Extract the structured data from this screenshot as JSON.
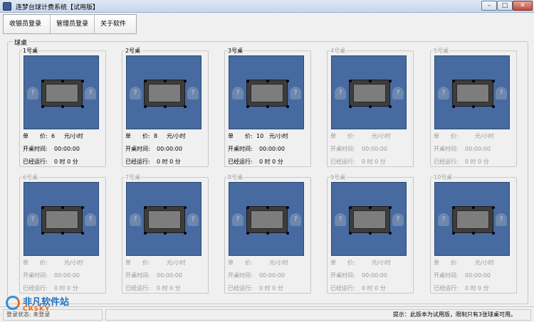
{
  "window": {
    "title": "连梦台球计费系统【试用版】",
    "controls": {
      "minimize": "–",
      "maximize": "□",
      "close": "✕"
    }
  },
  "toolbar": {
    "cashier_login": "收银员登录",
    "admin_login": "管理员登录",
    "about": "关于软件"
  },
  "group": {
    "label": "球桌"
  },
  "labels": {
    "price": "单　　价:",
    "open_time": "开桌时间:",
    "elapsed": "已经运行:"
  },
  "tables": [
    {
      "name": "1号桌",
      "active": true,
      "price": "6",
      "unit": "元/小时",
      "open_time": "00:00:00",
      "elapsed": "0  时 0  分"
    },
    {
      "name": "2号桌",
      "active": true,
      "price": "8",
      "unit": "元/小时",
      "open_time": "00:00:00",
      "elapsed": "0  时 0  分"
    },
    {
      "name": "3号桌",
      "active": true,
      "price": "10",
      "unit": "元/小时",
      "open_time": "00:00:00",
      "elapsed": "0  时 0  分"
    },
    {
      "name": "4号桌",
      "active": false,
      "price": "",
      "unit": "元/小时",
      "open_time": "00:00:00",
      "elapsed": "0  时 0  分"
    },
    {
      "name": "5号桌",
      "active": false,
      "price": "",
      "unit": "元/小时",
      "open_time": "00:00:00",
      "elapsed": "0  时 0  分"
    },
    {
      "name": "6号桌",
      "active": false,
      "price": "",
      "unit": "元/小时",
      "open_time": "00:00:00",
      "elapsed": "0  时 0  分"
    },
    {
      "name": "7号桌",
      "active": false,
      "price": "",
      "unit": "元/小时",
      "open_time": "00:00:00",
      "elapsed": "0  时 0  分"
    },
    {
      "name": "8号桌",
      "active": false,
      "price": "",
      "unit": "元/小时",
      "open_time": "00:00:00",
      "elapsed": "0  时 0  分"
    },
    {
      "name": "9号桌",
      "active": false,
      "price": "",
      "unit": "元/小时",
      "open_time": "00:00:00",
      "elapsed": "0  时 0  分"
    },
    {
      "name": "10号桌",
      "active": false,
      "price": "",
      "unit": "元/小时",
      "open_time": "00:00:00",
      "elapsed": "0  时 0  分"
    }
  ],
  "icons": {
    "unknown_player": "?"
  },
  "status": {
    "left": "登录状态: 未登录",
    "right": "提示：此版本为试用版，限制只有3张球桌可用。"
  },
  "watermark": {
    "brand": "非凡软件站",
    "sub": "CRSKY"
  }
}
